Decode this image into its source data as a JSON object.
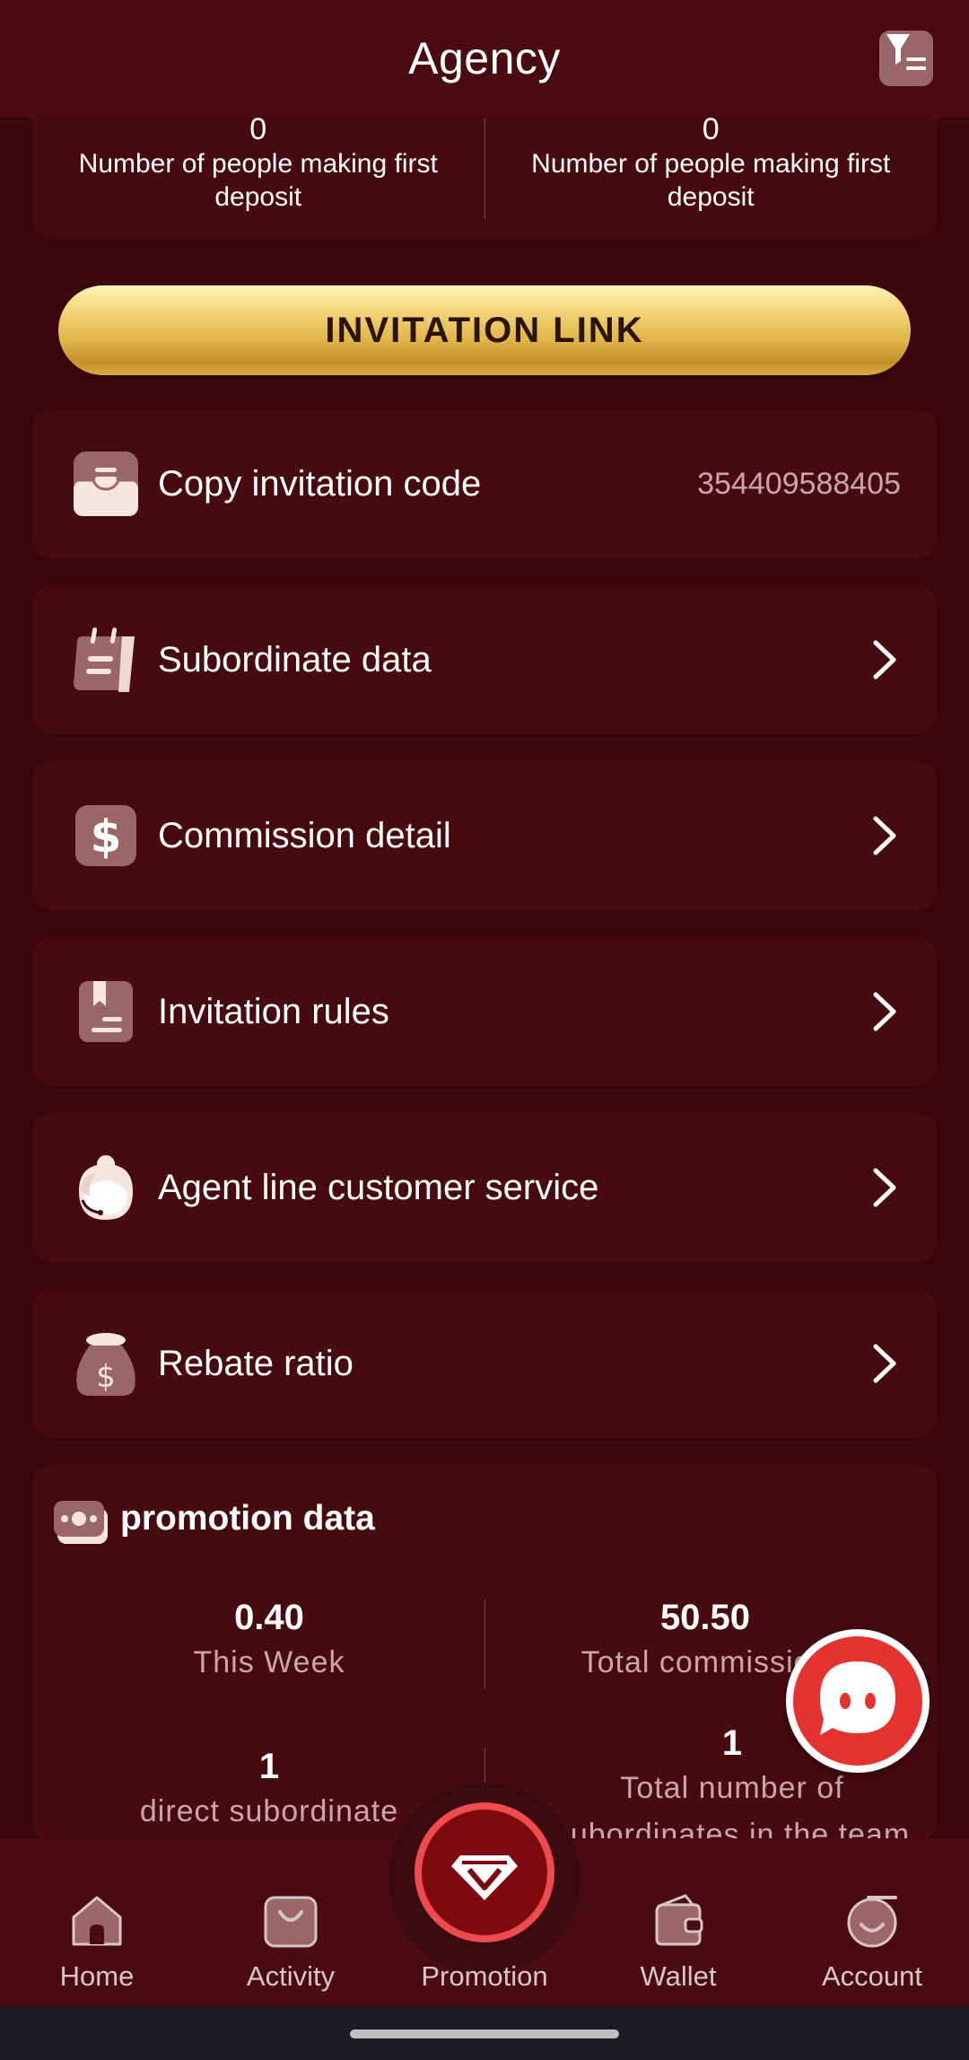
{
  "header": {
    "title": "Agency",
    "filter_icon": "filter-list-icon"
  },
  "stats_top": [
    {
      "value": "0",
      "label": "Number of people making first deposit"
    },
    {
      "value": "0",
      "label": "Number of people making first deposit"
    }
  ],
  "invitation_link": {
    "label": "INVITATION LINK"
  },
  "menu": {
    "copy_code": {
      "label": "Copy invitation code",
      "value": "354409588405",
      "icon": "tray-icon"
    },
    "subordinate_data": {
      "label": "Subordinate data",
      "icon": "calendar-icon"
    },
    "commission_detail": {
      "label": "Commission detail",
      "icon": "dollar-icon"
    },
    "invitation_rules": {
      "label": "Invitation rules",
      "icon": "bookmark-doc-icon"
    },
    "customer_service": {
      "label": "Agent line customer service",
      "icon": "agent-headset-icon"
    },
    "rebate_ratio": {
      "label": "Rebate ratio",
      "icon": "money-bag-icon"
    }
  },
  "promotion_data": {
    "title": "promotion data",
    "this_week": {
      "value": "0.40",
      "label": "This Week"
    },
    "total_commission": {
      "value": "50.50",
      "label": "Total commission"
    },
    "direct_subordinate": {
      "value": "1",
      "label": "direct subordinate"
    },
    "team_total": {
      "value": "1",
      "label": "Total number of subordinates in the team"
    }
  },
  "nav": {
    "home": "Home",
    "activity": "Activity",
    "promotion": "Promotion",
    "wallet": "Wallet",
    "account": "Account"
  },
  "colors": {
    "background": "#3b070d",
    "card": "#470a11",
    "gold": "#e2b649",
    "accent_red": "#ef4b4f"
  }
}
